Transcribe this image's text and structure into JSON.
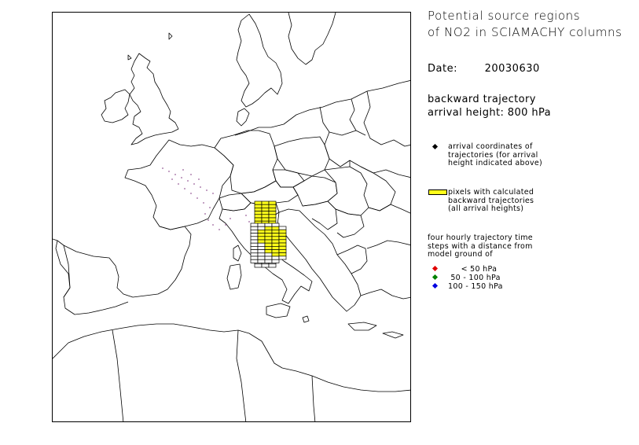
{
  "title_lines": [
    "Potential source regions",
    "of NO2 in SCIAMACHY columns"
  ],
  "date": {
    "label": "Date:",
    "value": "20030630"
  },
  "trajectory": {
    "line1": "backward trajectory",
    "line2": "arrival height: 800 hPa"
  },
  "legend": {
    "arrival": {
      "lines": [
        "arrival coordinates of",
        "trajectories (for arrival",
        "height indicated above)"
      ],
      "color": "#000000",
      "icon": "diamond-icon"
    },
    "pixels": {
      "lines": [
        "pixels with calculated",
        "backward trajectories",
        "(all arrival heights)"
      ],
      "color": "#ffff1a",
      "icon": "rectangle-icon"
    },
    "time_steps": {
      "lines": [
        "four hourly trajectory time",
        "steps with a distance from",
        "model ground of"
      ],
      "items": [
        {
          "label": "     < 50 hPa",
          "color": "#e00000"
        },
        {
          "label": " 50 - 100 hPa",
          "color": "#008000"
        },
        {
          "label": "100 - 150 hPa",
          "color": "#0000e0"
        }
      ]
    }
  }
}
